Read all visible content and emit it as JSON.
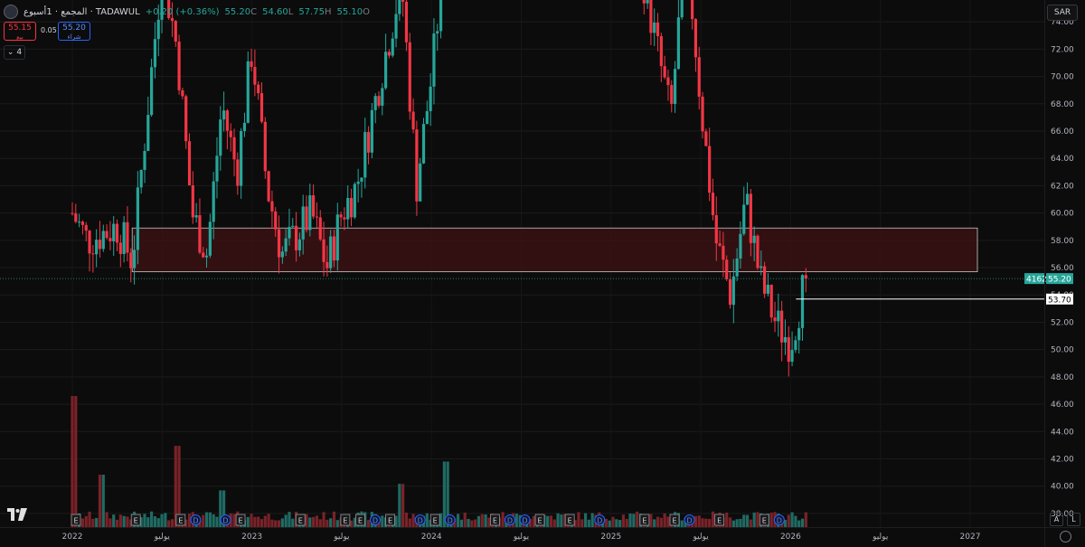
{
  "legend": {
    "symbol": "المجمع · 1أسبوع · TADAWUL",
    "change": "+0.20 (+0.36%)",
    "ohlc": [
      {
        "key": "C",
        "value": "55.20"
      },
      {
        "key": "L",
        "value": "54.60"
      },
      {
        "key": "H",
        "value": "57.75"
      },
      {
        "key": "O",
        "value": "55.10"
      }
    ]
  },
  "trade": {
    "sell_price": "55.15",
    "sell_label": "بيع",
    "spread": "0.05",
    "buy_price": "55.20",
    "buy_label": "شراء",
    "collapse_label": "4"
  },
  "currency": "SAR",
  "corner": {
    "auto_label": "A",
    "log_label": "L"
  },
  "colors": {
    "up": "#26a69a",
    "down": "#f23645",
    "zone_fill": "#3a1214",
    "zone_border": "#c9c9c9",
    "line_53_70": "#ffffff",
    "background": "#0c0c0c"
  },
  "chart_data": {
    "type": "candlestick",
    "timeframe": "1W",
    "y_ticks": [
      38,
      40,
      42,
      44,
      46,
      48,
      50,
      52,
      54,
      56,
      58,
      60,
      62,
      64,
      66,
      68,
      70,
      72,
      74
    ],
    "ylim": [
      37,
      75.6
    ],
    "x_labels": [
      "2022",
      "يوليو",
      "2023",
      "يوليو",
      "2024",
      "يوليو",
      "2025",
      "يوليو",
      "2026",
      "يوليو",
      "2027"
    ],
    "x_range": [
      "2022-01",
      "2027-02"
    ],
    "last_price": "55.20",
    "last_price_tag": "4162",
    "horizontal_line": {
      "value": 53.7,
      "label": "53.70"
    },
    "zone": {
      "top": 58.9,
      "bottom": 55.7,
      "from": "2022-05",
      "to": "2027-01"
    },
    "anchors": [
      {
        "date": "2022-01",
        "price": 60
      },
      {
        "date": "2022-02",
        "price": 58
      },
      {
        "date": "2022-04",
        "price": 59
      },
      {
        "date": "2022-05",
        "price": 56.5
      },
      {
        "date": "2022-07",
        "price": 78
      },
      {
        "date": "2022-08",
        "price": 72
      },
      {
        "date": "2022-09",
        "price": 60
      },
      {
        "date": "2022-10",
        "price": 57
      },
      {
        "date": "2022-11",
        "price": 68
      },
      {
        "date": "2022-12",
        "price": 63
      },
      {
        "date": "2023-01",
        "price": 72
      },
      {
        "date": "2023-02",
        "price": 62
      },
      {
        "date": "2023-03",
        "price": 57
      },
      {
        "date": "2023-05",
        "price": 60
      },
      {
        "date": "2023-06",
        "price": 56
      },
      {
        "date": "2023-07",
        "price": 60
      },
      {
        "date": "2023-08",
        "price": 62
      },
      {
        "date": "2023-09",
        "price": 67
      },
      {
        "date": "2023-10",
        "price": 72
      },
      {
        "date": "2023-11",
        "price": 77
      },
      {
        "date": "2023-12",
        "price": 62
      },
      {
        "date": "2024-01",
        "price": 70
      },
      {
        "date": "2024-02",
        "price": 80
      },
      {
        "date": "2025-03",
        "price": 78
      },
      {
        "date": "2025-05",
        "price": 67
      },
      {
        "date": "2025-06",
        "price": 80
      },
      {
        "date": "2025-07",
        "price": 68
      },
      {
        "date": "2025-08",
        "price": 58
      },
      {
        "date": "2025-09",
        "price": 54
      },
      {
        "date": "2025-10",
        "price": 61
      },
      {
        "date": "2025-11",
        "price": 55
      },
      {
        "date": "2025-12",
        "price": 52
      },
      {
        "date": "2026-01",
        "price": 50.5
      },
      {
        "date": "2026-02",
        "price": 55.2
      }
    ],
    "volume_spikes": [
      {
        "date": "2022-01",
        "level": 1.0
      },
      {
        "date": "2022-03",
        "level": 0.4
      },
      {
        "date": "2022-08",
        "level": 0.62
      },
      {
        "date": "2022-11",
        "level": 0.28
      },
      {
        "date": "2023-11",
        "level": 0.33
      },
      {
        "date": "2024-02",
        "level": 0.5
      }
    ],
    "events": [
      {
        "date": "2022-01",
        "label": "E"
      },
      {
        "date": "2022-05",
        "label": "E"
      },
      {
        "date": "2022-08",
        "label": "E"
      },
      {
        "date": "2022-09",
        "label": "D"
      },
      {
        "date": "2022-11",
        "label": "D"
      },
      {
        "date": "2022-12",
        "label": "E"
      },
      {
        "date": "2023-04",
        "label": "E"
      },
      {
        "date": "2023-07",
        "label": "E"
      },
      {
        "date": "2023-08",
        "label": "E"
      },
      {
        "date": "2023-09",
        "label": "D"
      },
      {
        "date": "2023-10",
        "label": "E"
      },
      {
        "date": "2023-12",
        "label": "D"
      },
      {
        "date": "2024-01",
        "label": "E"
      },
      {
        "date": "2024-02",
        "label": "D"
      },
      {
        "date": "2024-05",
        "label": "E"
      },
      {
        "date": "2024-06",
        "label": "D"
      },
      {
        "date": "2024-07",
        "label": "D"
      },
      {
        "date": "2024-08",
        "label": "E"
      },
      {
        "date": "2024-10",
        "label": "E"
      },
      {
        "date": "2024-12",
        "label": "D"
      },
      {
        "date": "2025-03",
        "label": "E"
      },
      {
        "date": "2025-05",
        "label": "E"
      },
      {
        "date": "2025-06",
        "label": "D"
      },
      {
        "date": "2025-08",
        "label": "E"
      },
      {
        "date": "2025-11",
        "label": "E"
      },
      {
        "date": "2025-12",
        "label": "D"
      }
    ]
  }
}
